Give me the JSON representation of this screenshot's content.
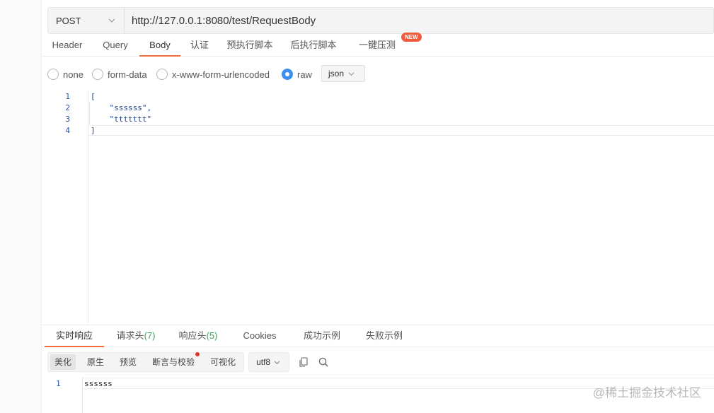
{
  "request": {
    "method": "POST",
    "url": "http://127.0.0.1:8080/test/RequestBody"
  },
  "request_tabs": [
    {
      "label": "Header"
    },
    {
      "label": "Query"
    },
    {
      "label": "Body",
      "active": true
    },
    {
      "label": "认证"
    },
    {
      "label": "预执行脚本"
    },
    {
      "label": "后执行脚本"
    },
    {
      "label": "一键压测"
    }
  ],
  "new_badge": "NEW",
  "body_types": [
    {
      "label": "none",
      "selected": false
    },
    {
      "label": "form-data",
      "selected": false
    },
    {
      "label": "x-www-form-urlencoded",
      "selected": false
    },
    {
      "label": "raw",
      "selected": true
    }
  ],
  "raw_format": "json",
  "editor": {
    "line_numbers": [
      "1",
      "2",
      "3",
      "4"
    ],
    "lines": [
      "[",
      "    \"ssssss\",",
      "    \"ttttttt\"",
      "]"
    ]
  },
  "response_tabs": [
    {
      "label": "实时响应",
      "active": true
    },
    {
      "label": "请求头",
      "count": "(7)"
    },
    {
      "label": "响应头",
      "count": "(5)"
    },
    {
      "label": "Cookies"
    },
    {
      "label": "成功示例"
    },
    {
      "label": "失败示例"
    }
  ],
  "response_toolbar": {
    "views": [
      {
        "label": "美化",
        "active": true
      },
      {
        "label": "原生"
      },
      {
        "label": "预览"
      },
      {
        "label": "断言与校验",
        "dot": true
      },
      {
        "label": "可视化"
      }
    ],
    "encoding": "utf8",
    "icons": [
      "copy-icon",
      "search-icon"
    ]
  },
  "response_body": {
    "line_number": "1",
    "text": "ssssss"
  },
  "watermark": "@稀土掘金技术社区",
  "colors": {
    "accent": "#f26b3a",
    "radio_selected": "#3d8ef0",
    "badge": "#ef5b3a",
    "count_green": "#3aa457",
    "code_blue": "#1d3f8f"
  }
}
